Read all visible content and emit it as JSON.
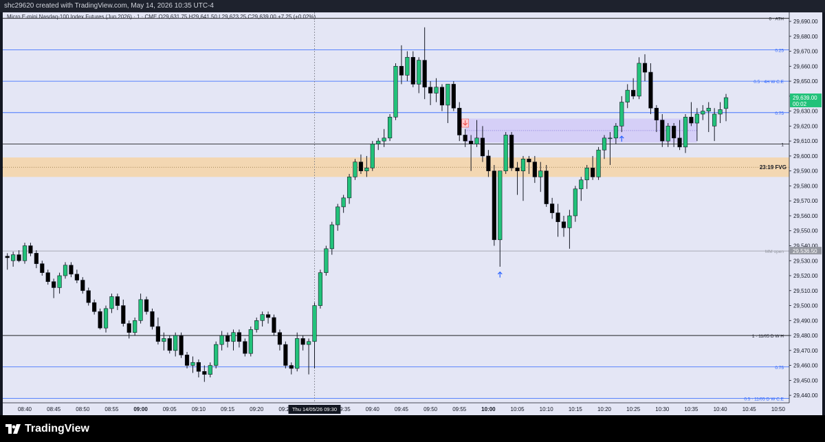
{
  "header": {
    "title": "shc29620 created with TradingView.com, May 14, 2026 10:35 UTC-4"
  },
  "legend": {
    "symbol": "Micro E-mini Nasdaq-100 Index Futures (Jun 2026) · 1 · CME",
    "ohlc": "O29,631.75  H29,641.50  L29,623.25  C29,639.00  +7.25 (+0.02%)"
  },
  "footer": {
    "brand": "TradingView"
  },
  "colors": {
    "up": "#22c27a",
    "down": "#000000",
    "bg": "#e4e6f5",
    "level_blue": "#2962ff",
    "fvg": "#f6d3a6",
    "zone": "#d3ccf7",
    "price_badge": "#22c27a"
  },
  "chart_data": {
    "type": "candlestick",
    "title": "",
    "ylim": [
      29435,
      29696
    ],
    "y_ticks": [
      "29,690.00",
      "29,680.00",
      "29,670.00",
      "29,660.00",
      "29,650.00",
      "29,640.00",
      "29,630.00",
      "29,620.00",
      "29,610.00",
      "29,600.00",
      "29,590.00",
      "29,580.00",
      "29,570.00",
      "29,560.00",
      "29,550.00",
      "29,540.00",
      "29,530.00",
      "29,520.00",
      "29,510.00",
      "29,500.00",
      "29,490.00",
      "29,480.00",
      "29,470.00",
      "29,460.00",
      "29,450.00",
      "29,440.00"
    ],
    "x_ticks": [
      "08:40",
      "08:45",
      "08:50",
      "08:55",
      "09:00",
      "09:05",
      "09:10",
      "09:15",
      "09:20",
      "09:25",
      "09:30",
      "09:35",
      "09:40",
      "09:45",
      "09:50",
      "09:55",
      "10:00",
      "10:05",
      "10:10",
      "10:15",
      "10:20",
      "10:25",
      "10:30",
      "10:35",
      "10:40",
      "10:45",
      "10:50"
    ],
    "crosshair_label": "Thu 14/05/26   09:30",
    "levels": [
      {
        "label": "0 · ATH",
        "price": 29692,
        "color": "#000000"
      },
      {
        "label": "0.25",
        "price": 29671,
        "color": "#2962ff"
      },
      {
        "label": "0.5 · 4H W C.E",
        "price": 29650,
        "color": "#2962ff"
      },
      {
        "label": "0.75",
        "price": 29629,
        "color": "#2962ff"
      },
      {
        "label": "1",
        "price": 29608,
        "color": "#000000"
      },
      {
        "label": "MM open",
        "price": 29536.5,
        "color": "#9598a1"
      },
      {
        "label": "1 · 11/05 D W H",
        "price": 29480,
        "color": "#000000"
      },
      {
        "label": "0.75",
        "price": 29459,
        "color": "#2962ff"
      },
      {
        "label": "0.5 · 11/05 D W C.E",
        "price": 29438,
        "color": "#2962ff"
      }
    ],
    "fvg": {
      "label": "23:19 FVG",
      "top": 29599,
      "bottom": 29586,
      "mid": 29592.5
    },
    "zone": {
      "top": 29625,
      "bottom": 29609,
      "start": "09:56",
      "end": "10:36"
    },
    "price_badges": [
      {
        "text": "29,639.00",
        "sub": "00:02",
        "price": 29639,
        "color": "#22c27a"
      },
      {
        "text": "29,536.50",
        "price": 29536.5,
        "color": "#9598a1"
      }
    ],
    "candles": [
      {
        "t": "08:37",
        "o": 29533,
        "h": 29535,
        "l": 29524,
        "c": 29532
      },
      {
        "t": "08:38",
        "o": 29530,
        "h": 29536,
        "l": 29526,
        "c": 29534
      },
      {
        "t": "08:39",
        "o": 29534,
        "h": 29537,
        "l": 29529,
        "c": 29530
      },
      {
        "t": "08:40",
        "o": 29530,
        "h": 29542,
        "l": 29528,
        "c": 29540
      },
      {
        "t": "08:41",
        "o": 29540,
        "h": 29542,
        "l": 29533,
        "c": 29535
      },
      {
        "t": "08:42",
        "o": 29535,
        "h": 29537,
        "l": 29525,
        "c": 29528
      },
      {
        "t": "08:43",
        "o": 29528,
        "h": 29530,
        "l": 29520,
        "c": 29522
      },
      {
        "t": "08:44",
        "o": 29522,
        "h": 29524,
        "l": 29514,
        "c": 29516
      },
      {
        "t": "08:45",
        "o": 29516,
        "h": 29518,
        "l": 29505,
        "c": 29512
      },
      {
        "t": "08:46",
        "o": 29512,
        "h": 29522,
        "l": 29508,
        "c": 29520
      },
      {
        "t": "08:47",
        "o": 29520,
        "h": 29529,
        "l": 29518,
        "c": 29527
      },
      {
        "t": "08:48",
        "o": 29527,
        "h": 29529,
        "l": 29519,
        "c": 29521
      },
      {
        "t": "08:49",
        "o": 29521,
        "h": 29524,
        "l": 29515,
        "c": 29517
      },
      {
        "t": "08:50",
        "o": 29517,
        "h": 29519,
        "l": 29508,
        "c": 29510
      },
      {
        "t": "08:51",
        "o": 29510,
        "h": 29512,
        "l": 29500,
        "c": 29502
      },
      {
        "t": "08:52",
        "o": 29502,
        "h": 29504,
        "l": 29494,
        "c": 29496
      },
      {
        "t": "08:53",
        "o": 29496,
        "h": 29498,
        "l": 29484,
        "c": 29485
      },
      {
        "t": "08:54",
        "o": 29485,
        "h": 29500,
        "l": 29482,
        "c": 29498
      },
      {
        "t": "08:55",
        "o": 29498,
        "h": 29508,
        "l": 29495,
        "c": 29506
      },
      {
        "t": "08:56",
        "o": 29506,
        "h": 29508,
        "l": 29497,
        "c": 29500
      },
      {
        "t": "08:57",
        "o": 29500,
        "h": 29504,
        "l": 29486,
        "c": 29488
      },
      {
        "t": "08:58",
        "o": 29488,
        "h": 29490,
        "l": 29478,
        "c": 29482
      },
      {
        "t": "08:59",
        "o": 29482,
        "h": 29492,
        "l": 29480,
        "c": 29490
      },
      {
        "t": "09:00",
        "o": 29490,
        "h": 29508,
        "l": 29488,
        "c": 29504
      },
      {
        "t": "09:01",
        "o": 29504,
        "h": 29506,
        "l": 29494,
        "c": 29496
      },
      {
        "t": "09:02",
        "o": 29496,
        "h": 29498,
        "l": 29484,
        "c": 29486
      },
      {
        "t": "09:03",
        "o": 29486,
        "h": 29492,
        "l": 29474,
        "c": 29476
      },
      {
        "t": "09:04",
        "o": 29476,
        "h": 29482,
        "l": 29470,
        "c": 29478
      },
      {
        "t": "09:05",
        "o": 29478,
        "h": 29480,
        "l": 29468,
        "c": 29470
      },
      {
        "t": "09:06",
        "o": 29470,
        "h": 29482,
        "l": 29466,
        "c": 29480
      },
      {
        "t": "09:07",
        "o": 29480,
        "h": 29482,
        "l": 29465,
        "c": 29467
      },
      {
        "t": "09:08",
        "o": 29467,
        "h": 29469,
        "l": 29458,
        "c": 29460
      },
      {
        "t": "09:09",
        "o": 29460,
        "h": 29466,
        "l": 29455,
        "c": 29462
      },
      {
        "t": "09:10",
        "o": 29462,
        "h": 29464,
        "l": 29452,
        "c": 29456
      },
      {
        "t": "09:11",
        "o": 29456,
        "h": 29460,
        "l": 29449,
        "c": 29454
      },
      {
        "t": "09:12",
        "o": 29454,
        "h": 29462,
        "l": 29452,
        "c": 29460
      },
      {
        "t": "09:13",
        "o": 29460,
        "h": 29476,
        "l": 29458,
        "c": 29474
      },
      {
        "t": "09:14",
        "o": 29474,
        "h": 29483,
        "l": 29470,
        "c": 29480
      },
      {
        "t": "09:15",
        "o": 29480,
        "h": 29482,
        "l": 29472,
        "c": 29476
      },
      {
        "t": "09:16",
        "o": 29476,
        "h": 29484,
        "l": 29470,
        "c": 29482
      },
      {
        "t": "09:17",
        "o": 29482,
        "h": 29484,
        "l": 29472,
        "c": 29476
      },
      {
        "t": "09:18",
        "o": 29476,
        "h": 29478,
        "l": 29466,
        "c": 29468
      },
      {
        "t": "09:19",
        "o": 29468,
        "h": 29486,
        "l": 29466,
        "c": 29484
      },
      {
        "t": "09:20",
        "o": 29484,
        "h": 29492,
        "l": 29482,
        "c": 29490
      },
      {
        "t": "09:21",
        "o": 29490,
        "h": 29496,
        "l": 29486,
        "c": 29494
      },
      {
        "t": "09:22",
        "o": 29494,
        "h": 29496,
        "l": 29488,
        "c": 29492
      },
      {
        "t": "09:23",
        "o": 29492,
        "h": 29494,
        "l": 29480,
        "c": 29482
      },
      {
        "t": "09:24",
        "o": 29482,
        "h": 29484,
        "l": 29470,
        "c": 29474
      },
      {
        "t": "09:25",
        "o": 29474,
        "h": 29476,
        "l": 29458,
        "c": 29460
      },
      {
        "t": "09:26",
        "o": 29460,
        "h": 29462,
        "l": 29454,
        "c": 29458
      },
      {
        "t": "09:27",
        "o": 29458,
        "h": 29482,
        "l": 29456,
        "c": 29478
      },
      {
        "t": "09:28",
        "o": 29478,
        "h": 29480,
        "l": 29470,
        "c": 29474
      },
      {
        "t": "09:29",
        "o": 29474,
        "h": 29478,
        "l": 29454,
        "c": 29476
      },
      {
        "t": "09:30",
        "o": 29476,
        "h": 29502,
        "l": 29458,
        "c": 29500
      },
      {
        "t": "09:31",
        "o": 29500,
        "h": 29524,
        "l": 29498,
        "c": 29522
      },
      {
        "t": "09:32",
        "o": 29522,
        "h": 29540,
        "l": 29520,
        "c": 29538
      },
      {
        "t": "09:33",
        "o": 29538,
        "h": 29556,
        "l": 29534,
        "c": 29554
      },
      {
        "t": "09:34",
        "o": 29554,
        "h": 29568,
        "l": 29550,
        "c": 29566
      },
      {
        "t": "09:35",
        "o": 29566,
        "h": 29574,
        "l": 29562,
        "c": 29572
      },
      {
        "t": "09:36",
        "o": 29572,
        "h": 29588,
        "l": 29568,
        "c": 29586
      },
      {
        "t": "09:37",
        "o": 29586,
        "h": 29598,
        "l": 29584,
        "c": 29596
      },
      {
        "t": "09:38",
        "o": 29596,
        "h": 29601,
        "l": 29588,
        "c": 29590
      },
      {
        "t": "09:39",
        "o": 29590,
        "h": 29600,
        "l": 29586,
        "c": 29592
      },
      {
        "t": "09:40",
        "o": 29592,
        "h": 29610,
        "l": 29590,
        "c": 29608
      },
      {
        "t": "09:41",
        "o": 29608,
        "h": 29612,
        "l": 29604,
        "c": 29610
      },
      {
        "t": "09:42",
        "o": 29610,
        "h": 29618,
        "l": 29606,
        "c": 29612
      },
      {
        "t": "09:43",
        "o": 29612,
        "h": 29628,
        "l": 29610,
        "c": 29626
      },
      {
        "t": "09:44",
        "o": 29626,
        "h": 29662,
        "l": 29624,
        "c": 29660
      },
      {
        "t": "09:45",
        "o": 29660,
        "h": 29674,
        "l": 29648,
        "c": 29654
      },
      {
        "t": "09:46",
        "o": 29654,
        "h": 29670,
        "l": 29650,
        "c": 29666
      },
      {
        "t": "09:47",
        "o": 29666,
        "h": 29670,
        "l": 29646,
        "c": 29648
      },
      {
        "t": "09:48",
        "o": 29648,
        "h": 29666,
        "l": 29642,
        "c": 29664
      },
      {
        "t": "09:49",
        "o": 29664,
        "h": 29686,
        "l": 29638,
        "c": 29646
      },
      {
        "t": "09:50",
        "o": 29646,
        "h": 29650,
        "l": 29634,
        "c": 29642
      },
      {
        "t": "09:51",
        "o": 29642,
        "h": 29652,
        "l": 29636,
        "c": 29646
      },
      {
        "t": "09:52",
        "o": 29646,
        "h": 29648,
        "l": 29630,
        "c": 29634
      },
      {
        "t": "09:53",
        "o": 29634,
        "h": 29646,
        "l": 29622,
        "c": 29648
      },
      {
        "t": "09:54",
        "o": 29648,
        "h": 29650,
        "l": 29630,
        "c": 29632
      },
      {
        "t": "09:55",
        "o": 29632,
        "h": 29636,
        "l": 29610,
        "c": 29614
      },
      {
        "t": "09:56",
        "o": 29614,
        "h": 29618,
        "l": 29606,
        "c": 29610
      },
      {
        "t": "09:57",
        "o": 29610,
        "h": 29614,
        "l": 29590,
        "c": 29608
      },
      {
        "t": "09:58",
        "o": 29608,
        "h": 29624,
        "l": 29606,
        "c": 29612
      },
      {
        "t": "09:59",
        "o": 29612,
        "h": 29620,
        "l": 29596,
        "c": 29600
      },
      {
        "t": "10:00",
        "o": 29600,
        "h": 29604,
        "l": 29586,
        "c": 29590
      },
      {
        "t": "10:01",
        "o": 29590,
        "h": 29594,
        "l": 29540,
        "c": 29544
      },
      {
        "t": "10:02",
        "o": 29544,
        "h": 29588,
        "l": 29526,
        "c": 29590
      },
      {
        "t": "10:03",
        "o": 29590,
        "h": 29616,
        "l": 29588,
        "c": 29614
      },
      {
        "t": "10:04",
        "o": 29614,
        "h": 29616,
        "l": 29590,
        "c": 29592
      },
      {
        "t": "10:05",
        "o": 29592,
        "h": 29596,
        "l": 29574,
        "c": 29590
      },
      {
        "t": "10:06",
        "o": 29590,
        "h": 29600,
        "l": 29570,
        "c": 29598
      },
      {
        "t": "10:07",
        "o": 29598,
        "h": 29600,
        "l": 29588,
        "c": 29596
      },
      {
        "t": "10:08",
        "o": 29596,
        "h": 29600,
        "l": 29582,
        "c": 29586
      },
      {
        "t": "10:09",
        "o": 29586,
        "h": 29596,
        "l": 29576,
        "c": 29590
      },
      {
        "t": "10:10",
        "o": 29590,
        "h": 29594,
        "l": 29566,
        "c": 29568
      },
      {
        "t": "10:11",
        "o": 29568,
        "h": 29572,
        "l": 29558,
        "c": 29562
      },
      {
        "t": "10:12",
        "o": 29562,
        "h": 29568,
        "l": 29546,
        "c": 29556
      },
      {
        "t": "10:13",
        "o": 29556,
        "h": 29560,
        "l": 29546,
        "c": 29552
      },
      {
        "t": "10:14",
        "o": 29552,
        "h": 29564,
        "l": 29538,
        "c": 29560
      },
      {
        "t": "10:15",
        "o": 29560,
        "h": 29580,
        "l": 29556,
        "c": 29578
      },
      {
        "t": "10:16",
        "o": 29578,
        "h": 29586,
        "l": 29570,
        "c": 29584
      },
      {
        "t": "10:17",
        "o": 29584,
        "h": 29594,
        "l": 29578,
        "c": 29592
      },
      {
        "t": "10:18",
        "o": 29592,
        "h": 29600,
        "l": 29584,
        "c": 29586
      },
      {
        "t": "10:19",
        "o": 29586,
        "h": 29606,
        "l": 29584,
        "c": 29604
      },
      {
        "t": "10:20",
        "o": 29604,
        "h": 29614,
        "l": 29598,
        "c": 29612
      },
      {
        "t": "10:21",
        "o": 29612,
        "h": 29616,
        "l": 29594,
        "c": 29612
      },
      {
        "t": "10:22",
        "o": 29612,
        "h": 29622,
        "l": 29608,
        "c": 29620
      },
      {
        "t": "10:23",
        "o": 29620,
        "h": 29640,
        "l": 29616,
        "c": 29636
      },
      {
        "t": "10:24",
        "o": 29636,
        "h": 29648,
        "l": 29632,
        "c": 29644
      },
      {
        "t": "10:25",
        "o": 29644,
        "h": 29652,
        "l": 29638,
        "c": 29640
      },
      {
        "t": "10:26",
        "o": 29640,
        "h": 29666,
        "l": 29638,
        "c": 29662
      },
      {
        "t": "10:27",
        "o": 29662,
        "h": 29668,
        "l": 29650,
        "c": 29656
      },
      {
        "t": "10:28",
        "o": 29656,
        "h": 29662,
        "l": 29628,
        "c": 29632
      },
      {
        "t": "10:29",
        "o": 29632,
        "h": 29634,
        "l": 29616,
        "c": 29624
      },
      {
        "t": "10:30",
        "o": 29624,
        "h": 29628,
        "l": 29606,
        "c": 29610
      },
      {
        "t": "10:31",
        "o": 29610,
        "h": 29622,
        "l": 29606,
        "c": 29620
      },
      {
        "t": "10:32",
        "o": 29620,
        "h": 29622,
        "l": 29606,
        "c": 29612
      },
      {
        "t": "10:33",
        "o": 29612,
        "h": 29624,
        "l": 29604,
        "c": 29606
      },
      {
        "t": "10:34",
        "o": 29606,
        "h": 29628,
        "l": 29602,
        "c": 29626
      },
      {
        "t": "10:35",
        "o": 29626,
        "h": 29636,
        "l": 29620,
        "c": 29622
      },
      {
        "t": "10:36",
        "o": 29622,
        "h": 29632,
        "l": 29610,
        "c": 29628
      },
      {
        "t": "10:37",
        "o": 29628,
        "h": 29634,
        "l": 29624,
        "c": 29630
      },
      {
        "t": "10:38",
        "o": 29630,
        "h": 29636,
        "l": 29616,
        "c": 29632
      },
      {
        "t": "10:39",
        "o": 29620,
        "h": 29632,
        "l": 29610,
        "c": 29628
      },
      {
        "t": "10:40",
        "o": 29628,
        "h": 29636,
        "l": 29622,
        "c": 29631
      },
      {
        "t": "10:41",
        "o": 29631.75,
        "h": 29641.5,
        "l": 29623.25,
        "c": 29639
      }
    ]
  }
}
